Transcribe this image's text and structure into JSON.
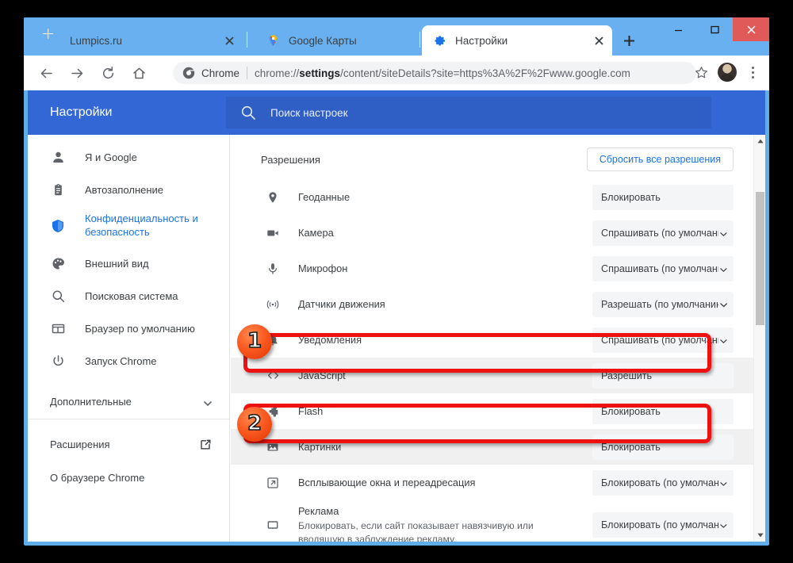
{
  "window": {
    "controls": {
      "minimize": "minimize-icon",
      "maximize": "maximize-icon",
      "close": "close-icon"
    }
  },
  "tabs": [
    {
      "title": "Lumpics.ru",
      "favicon": "orange-slice-icon",
      "active": false
    },
    {
      "title": "Google Карты",
      "favicon": "google-maps-pin-icon",
      "active": false
    },
    {
      "title": "Настройки",
      "favicon": "settings-gear-icon",
      "active": true
    }
  ],
  "toolbar": {
    "back": "back-arrow-icon",
    "forward": "forward-arrow-icon",
    "reload": "reload-icon",
    "home": "home-icon",
    "omnibox": {
      "chrome_label": "Chrome",
      "url_prefix": "chrome://",
      "url_bold": "settings",
      "url_suffix": "/content/siteDetails?site=https%3A%2F%2Fwww.google.com"
    },
    "bookmark": "star-icon",
    "profile": "avatar",
    "menu": "three-dots-icon"
  },
  "settings": {
    "title": "Настройки",
    "search_placeholder": "Поиск настроек"
  },
  "sidebar": {
    "items": [
      {
        "label": "Я и Google",
        "icon": "person-icon",
        "selected": false
      },
      {
        "label": "Автозаполнение",
        "icon": "clipboard-icon",
        "selected": false
      },
      {
        "label": "Конфиденциальность и безопасность",
        "icon": "shield-icon",
        "selected": true
      },
      {
        "label": "Внешний вид",
        "icon": "palette-icon",
        "selected": false
      },
      {
        "label": "Поисковая система",
        "icon": "search-icon",
        "selected": false
      },
      {
        "label": "Браузер по умолчанию",
        "icon": "browser-window-icon",
        "selected": false
      },
      {
        "label": "Запуск Chrome",
        "icon": "power-icon",
        "selected": false
      }
    ],
    "advanced": {
      "label": "Дополнительные",
      "icon": "chevron-down-icon"
    },
    "extensions": {
      "label": "Расширения",
      "icon": "external-link-icon"
    },
    "about": {
      "label": "О браузере Chrome"
    }
  },
  "main": {
    "section_title": "Разрешения",
    "reset_button": "Сбросить все разрешения",
    "permissions": [
      {
        "label": "Геоданные",
        "icon": "location-pin-icon",
        "value": "Блокировать",
        "desc": ""
      },
      {
        "label": "Камера",
        "icon": "camera-icon",
        "value": "Спрашивать (по умолчанию)",
        "desc": ""
      },
      {
        "label": "Микрофон",
        "icon": "microphone-icon",
        "value": "Спрашивать (по умолчанию)",
        "desc": ""
      },
      {
        "label": "Датчики движения",
        "icon": "motion-sensor-icon",
        "value": "Разрешать (по умолчанию)",
        "desc": ""
      },
      {
        "label": "Уведомления",
        "icon": "bell-icon",
        "value": "Спрашивать (по умолчанию)",
        "desc": ""
      },
      {
        "label": "JavaScript",
        "icon": "code-brackets-icon",
        "value": "Разрешить",
        "desc": ""
      },
      {
        "label": "Flash",
        "icon": "puzzle-piece-icon",
        "value": "Блокировать",
        "desc": ""
      },
      {
        "label": "Картинки",
        "icon": "image-icon",
        "value": "Блокировать",
        "desc": ""
      },
      {
        "label": "Всплывающие окна и переадресация",
        "icon": "popup-window-icon",
        "value": "Блокировать (по умолчанию)",
        "desc": ""
      },
      {
        "label": "Реклама",
        "icon": "ad-block-icon",
        "value": "Блокировать (по умолчанию)",
        "desc": "Блокировать, если сайт показывает навязчивую или вводящую в заблуждение рекламу."
      }
    ]
  },
  "annotations": {
    "badges": [
      {
        "number": "1",
        "target": "JavaScript"
      },
      {
        "number": "2",
        "target": "Картинки"
      }
    ],
    "highlight_color": "#ee1111"
  },
  "colors": {
    "window_frame": "#5fade9",
    "tabstrip": "#68b0ef",
    "settings_header": "#3367d6",
    "accent_blue": "#1a73e8"
  }
}
